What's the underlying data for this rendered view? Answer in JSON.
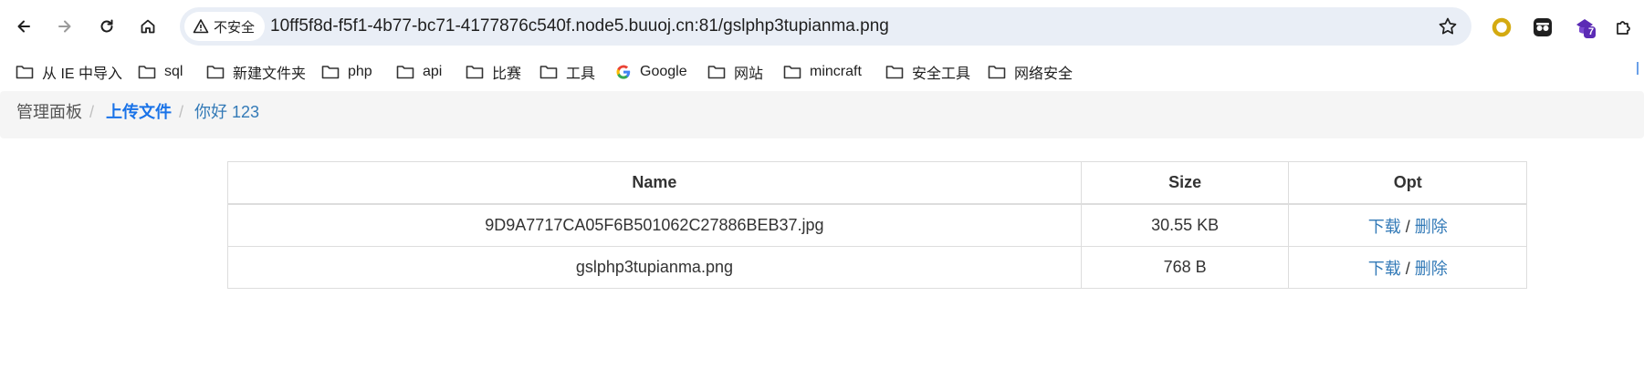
{
  "browser": {
    "security_label": "不安全",
    "url": "10ff5f8d-f5f1-4b77-bc71-4177876c540f.node5.buuoj.cn:81/gslphp3tupianma.png",
    "extension_badge": "7"
  },
  "bookmarks": [
    {
      "label": "从 IE 中导入",
      "icon": "folder-icon"
    },
    {
      "label": "sql",
      "icon": "folder-icon"
    },
    {
      "label": "新建文件夹",
      "icon": "folder-icon"
    },
    {
      "label": "php",
      "icon": "folder-icon"
    },
    {
      "label": "api",
      "icon": "folder-icon"
    },
    {
      "label": "比赛",
      "icon": "folder-icon"
    },
    {
      "label": "工具",
      "icon": "folder-icon"
    },
    {
      "label": "Google",
      "icon": "google-icon"
    },
    {
      "label": "网站",
      "icon": "folder-icon"
    },
    {
      "label": "mincraft",
      "icon": "folder-icon"
    },
    {
      "label": "安全工具",
      "icon": "folder-icon"
    },
    {
      "label": "网络安全",
      "icon": "folder-icon"
    }
  ],
  "breadcrumb": {
    "home": "管理面板",
    "upload": "上传文件",
    "user": "你好 123",
    "separator": "/"
  },
  "table": {
    "headers": {
      "name": "Name",
      "size": "Size",
      "opt": "Opt"
    },
    "rows": [
      {
        "name": "9D9A7717CA05F6B501062C27886BEB37.jpg",
        "size": "30.55 KB",
        "download": "下载",
        "sep": "/",
        "delete": "删除"
      },
      {
        "name": "gslphp3tupianma.png",
        "size": "768 B",
        "download": "下载",
        "sep": "/",
        "delete": "删除"
      }
    ]
  },
  "colors": {
    "link": "#337ab7",
    "active_crumb": "#1a73e8",
    "breadcrumb_bg": "#f5f5f5",
    "omnibox_bg": "#e9eef6"
  }
}
